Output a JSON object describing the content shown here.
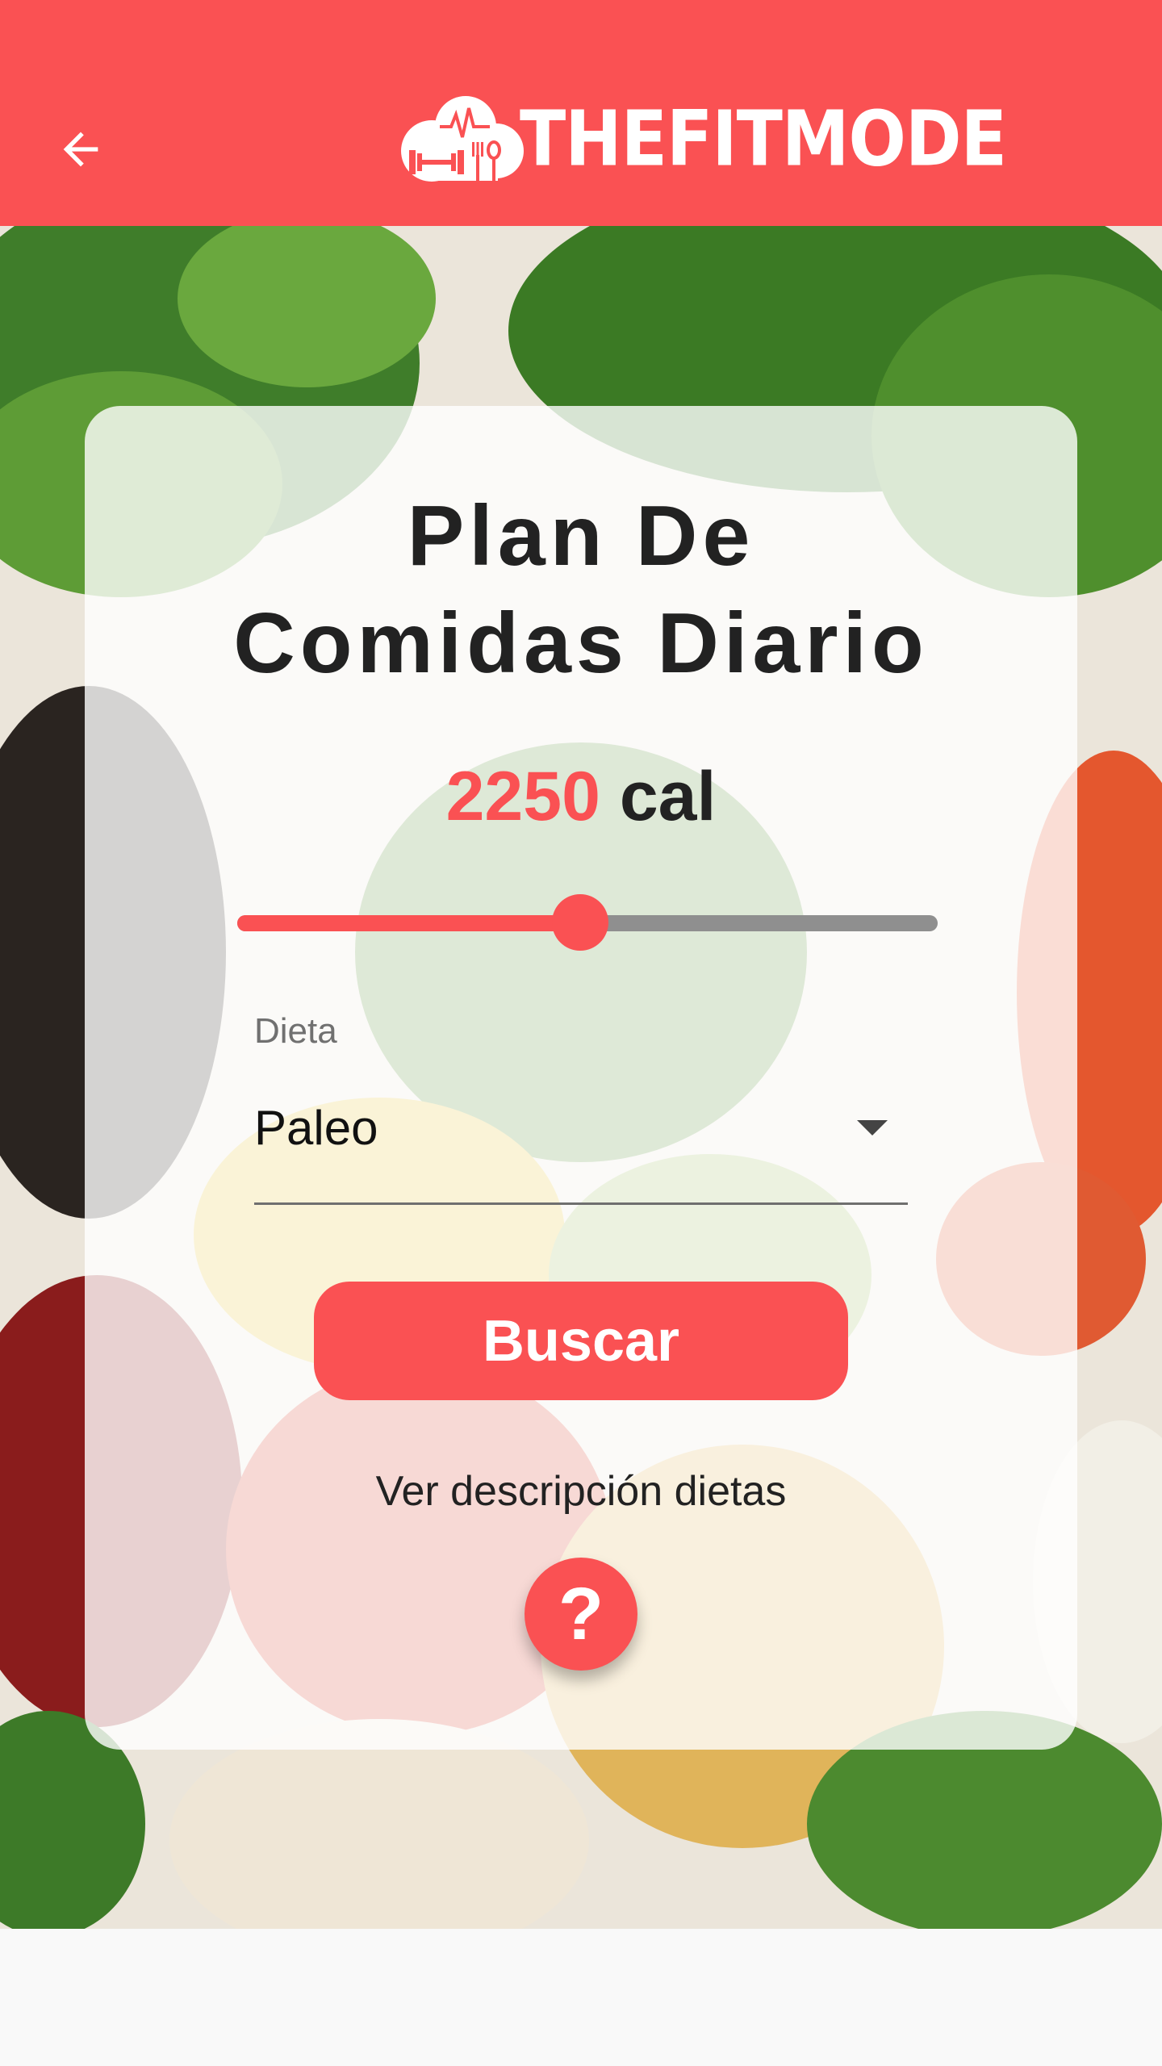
{
  "appbar": {
    "brand": "THEFITMODE",
    "back_icon": "arrow-left-icon",
    "background": "#fa5153"
  },
  "card": {
    "title_line1": "Plan De",
    "title_line2": "Comidas Diario",
    "calories_value": "2250",
    "calories_unit": "cal",
    "slider_fraction": 0.49,
    "diet_label": "Dieta",
    "diet_value": "Paleo",
    "search_label": "Buscar",
    "diet_link": "Ver descripción dietas",
    "help_label": "?"
  },
  "colors": {
    "accent": "#fa5153",
    "text": "#222222",
    "track": "#8f8f8f"
  }
}
